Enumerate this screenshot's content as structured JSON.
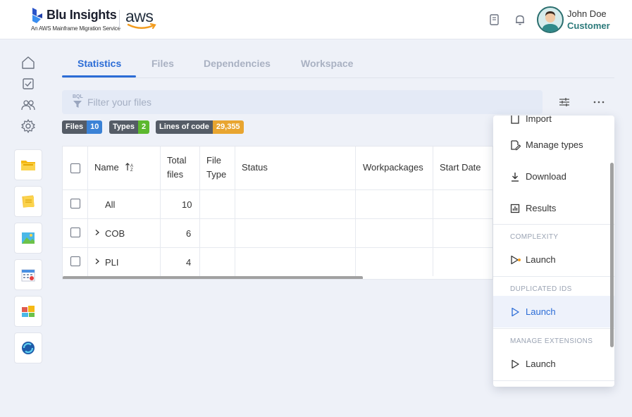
{
  "brand": {
    "name": "Blu Insights",
    "subtitle": "An AWS Mainframe Migration Service",
    "partner": "aws"
  },
  "user": {
    "name": "John Doe",
    "role": "Customer"
  },
  "tabs": [
    {
      "label": "Statistics",
      "active": true
    },
    {
      "label": "Files",
      "active": false
    },
    {
      "label": "Dependencies",
      "active": false
    },
    {
      "label": "Workspace",
      "active": false
    }
  ],
  "filter": {
    "tag": "BQL",
    "placeholder": "Filter your files",
    "value": ""
  },
  "badges": [
    {
      "label": "Files",
      "value": "10",
      "color": "#3b82d6"
    },
    {
      "label": "Types",
      "value": "2",
      "color": "#5cb82e"
    },
    {
      "label": "Lines of code",
      "value": "29,355",
      "color": "#e8a530"
    }
  ],
  "table": {
    "headers": {
      "name": "Name",
      "total_files_1": "Total",
      "total_files_2": "files",
      "file_type_1": "File",
      "file_type_2": "Type",
      "status": "Status",
      "workpackages": "Workpackages",
      "start_date": "Start Date"
    },
    "rows": [
      {
        "name": "All",
        "total": "10",
        "expandable": false
      },
      {
        "name": "COB",
        "total": "6",
        "expandable": true
      },
      {
        "name": "PLI",
        "total": "4",
        "expandable": true
      }
    ]
  },
  "menu": {
    "partial_top": "Import",
    "manage_types": "Manage types",
    "download": "Download",
    "results": "Results",
    "complexity_header": "COMPLEXITY",
    "complexity_launch": "Launch",
    "duplicated_header": "DUPLICATED IDS",
    "duplicated_launch": "Launch",
    "extensions_header": "MANAGE EXTENSIONS",
    "extensions_launch": "Launch"
  },
  "colors": {
    "accent": "#2b6cd6",
    "role": "#2c7a7b",
    "header_bg": "#ffffff",
    "page_bg": "#eef1f8"
  }
}
